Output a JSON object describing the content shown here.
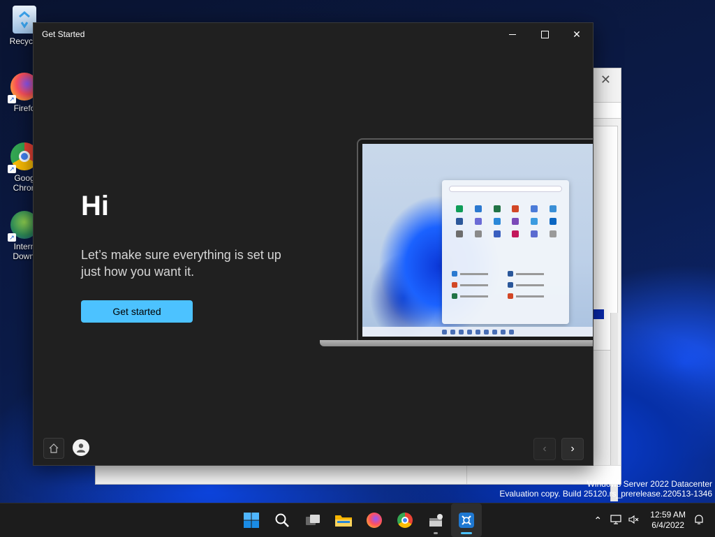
{
  "desktop": {
    "icons": [
      {
        "label": "Recycle",
        "name": "recycle-bin-icon"
      },
      {
        "label": "Firefo",
        "name": "firefox-desktop-icon"
      },
      {
        "label": "Goog\nChron",
        "name": "chrome-desktop-icon"
      },
      {
        "label": "Intern\nDownl",
        "name": "idm-desktop-icon"
      }
    ],
    "watermark": {
      "line1": "Windows Server 2022 Datacenter",
      "line2": "Evaluation copy. Build 25120.rs_prerelease.220513-1346"
    }
  },
  "window": {
    "title": "Get Started",
    "heading": "Hi",
    "subtitle": "Let’s make sure everything is set up just how you want it.",
    "primary_button": "Get started",
    "colors": {
      "accent": "#4cc2ff",
      "background": "#202020"
    }
  },
  "taskbar": {
    "apps": [
      {
        "name": "start-icon"
      },
      {
        "name": "search-icon"
      },
      {
        "name": "task-view-icon"
      },
      {
        "name": "file-explorer-icon"
      },
      {
        "name": "firefox-icon"
      },
      {
        "name": "chrome-icon"
      },
      {
        "name": "installer-icon"
      },
      {
        "name": "get-started-icon"
      }
    ],
    "time": "12:59 AM",
    "date": "6/4/2022"
  }
}
